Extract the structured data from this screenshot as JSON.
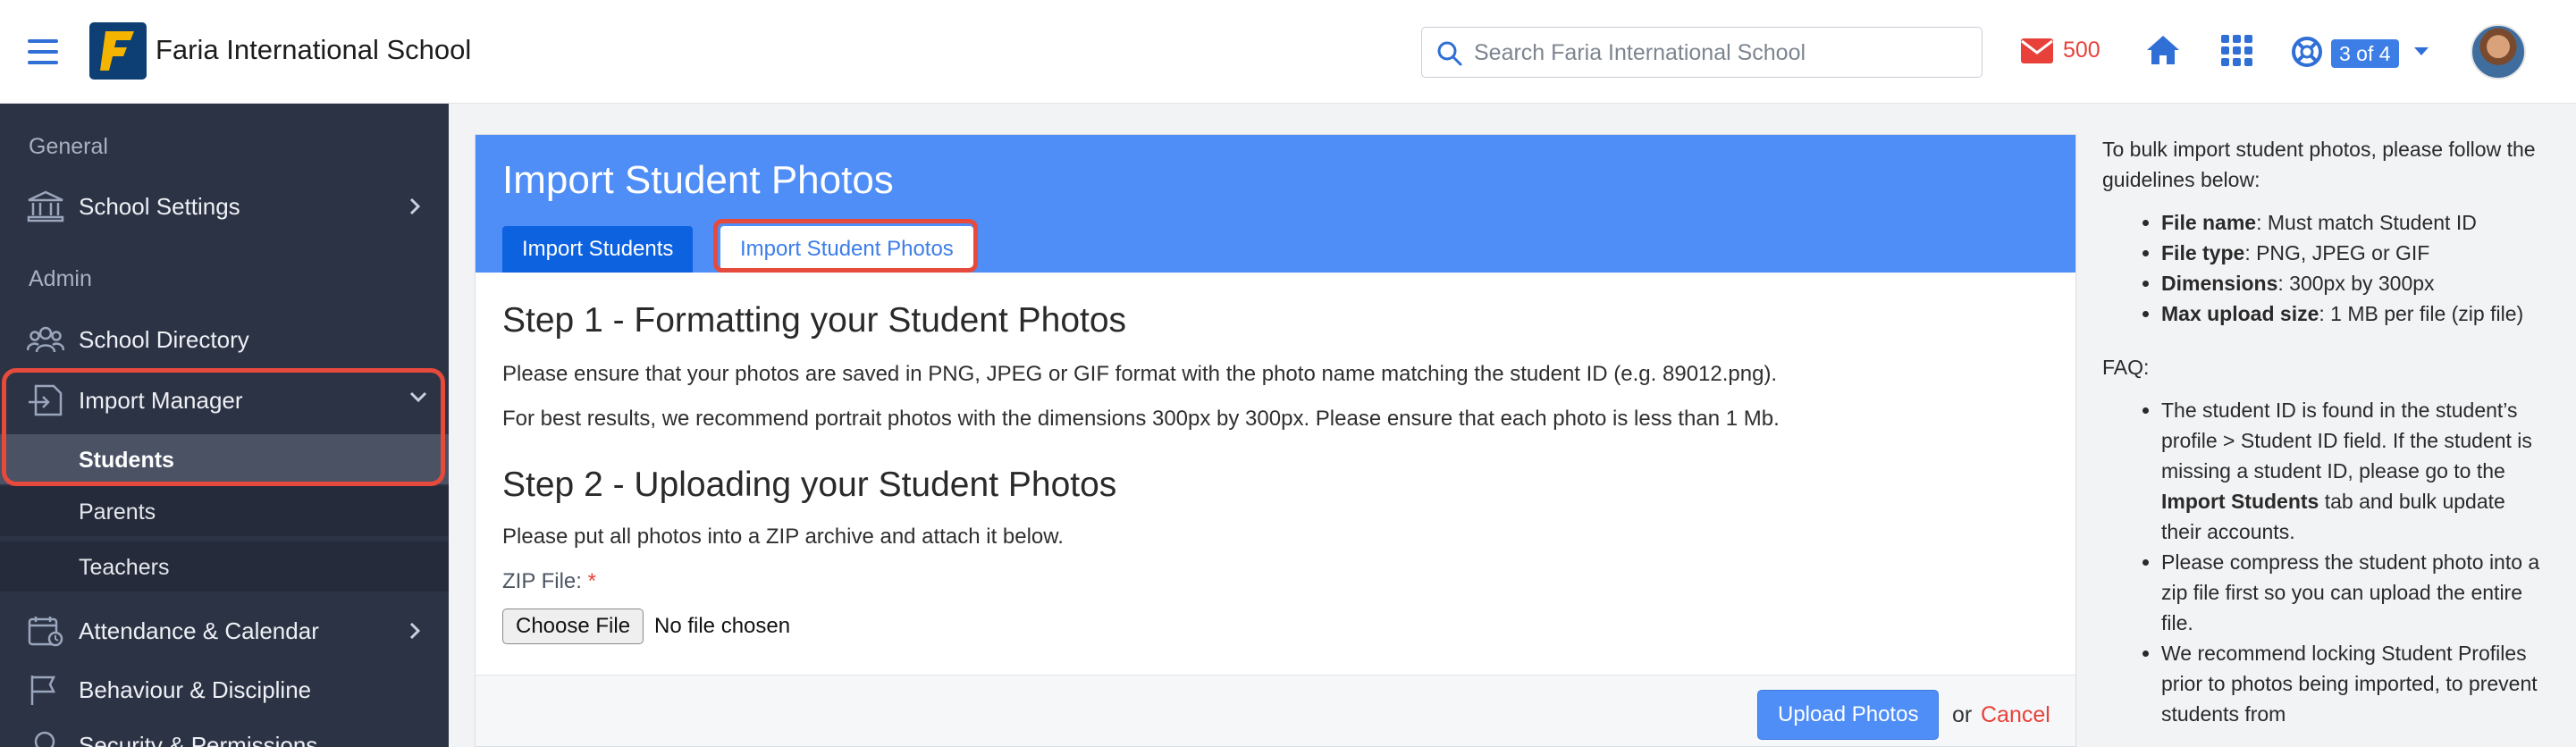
{
  "header": {
    "app_title": "Faria International School",
    "search_placeholder": "Search Faria International School",
    "mail_count": "500",
    "help_badge": "3 of 4"
  },
  "sidebar": {
    "section_general": "General",
    "section_admin": "Admin",
    "items": {
      "school_settings": "School Settings",
      "school_directory": "School Directory",
      "import_manager": "Import Manager",
      "students": "Students",
      "parents": "Parents",
      "teachers": "Teachers",
      "attendance": "Attendance & Calendar",
      "behaviour": "Behaviour & Discipline",
      "security": "Security & Permissions"
    }
  },
  "main": {
    "title": "Import Student Photos",
    "tabs": [
      "Import Students",
      "Import Student Photos"
    ],
    "step1_title": "Step 1 - Formatting your Student Photos",
    "step1_p1": "Please ensure that your photos are saved in PNG, JPEG or GIF format with the photo name matching the student ID (e.g. 89012.png).",
    "step1_p2": "For best results, we recommend portrait photos with the dimensions 300px by 300px. Please ensure that each photo is less than 1 Mb.",
    "step2_title": "Step 2 - Uploading your Student Photos",
    "step2_p1": "Please put all photos into a ZIP archive and attach it below.",
    "zip_label": "ZIP File:",
    "required_mark": "*",
    "choose_file": "Choose File",
    "file_status": "No file chosen",
    "upload_button": "Upload Photos",
    "or": "or",
    "cancel": "Cancel"
  },
  "help": {
    "intro": "To bulk import student photos, please follow the guidelines below:",
    "guidelines": [
      {
        "label": "File name",
        "text": ": Must match Student ID"
      },
      {
        "label": "File type",
        "text": ": PNG, JPEG or GIF"
      },
      {
        "label": "Dimensions",
        "text": ": 300px by 300px"
      },
      {
        "label": "Max upload size",
        "text": ": 1 MB per file (zip file)"
      }
    ],
    "faq_title": "FAQ:",
    "faq1_before": "The student ID is found in the student’s profile > Student ID field. If the student is missing a student ID, please go to the ",
    "faq1_bold": "Import Students",
    "faq1_after": " tab and bulk update their accounts.",
    "faq2": "Please compress the student photo into a zip file first so you can upload the entire file.",
    "faq3": "We recommend locking Student Profiles prior to photos being imported, to prevent students from"
  },
  "colors": {
    "brand_blue": "#4f8ef7",
    "sidebar_bg": "#2c3344",
    "highlight_red": "#e64a3c",
    "alert_red": "#e8413a"
  },
  "icons": [
    "hamburger-icon",
    "logo-icon",
    "search-icon",
    "mail-icon",
    "home-icon",
    "apps-grid-icon",
    "lifebuoy-icon",
    "bank-icon",
    "users-icon",
    "import-icon",
    "calendar-icon",
    "flag-icon",
    "lock-icon",
    "chevron-right-icon",
    "chevron-down-icon"
  ]
}
